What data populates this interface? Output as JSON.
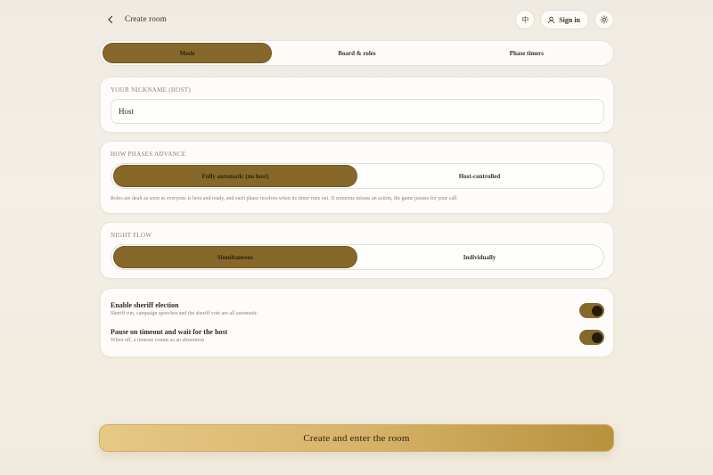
{
  "header": {
    "title": "Create room",
    "lang_glyph": "中",
    "signin_label": "Sign in"
  },
  "tabs": [
    {
      "label": "Mode",
      "active": true
    },
    {
      "label": "Board & roles",
      "active": false
    },
    {
      "label": "Phase timers",
      "active": false
    }
  ],
  "nickname": {
    "label": "YOUR NICKNAME (HOST)",
    "value": "Host"
  },
  "phases": {
    "label": "HOW PHASES ADVANCE",
    "options": [
      {
        "label": "Fully automatic (no host)",
        "active": true
      },
      {
        "label": "Host-controlled",
        "active": false
      }
    ],
    "note": "Roles are dealt as soon as everyone is here and ready, and each phase resolves when its timer runs out. If someone misses an action, the game pauses for your call."
  },
  "night": {
    "label": "NIGHT FLOW",
    "options": [
      {
        "label": "Simultaneous",
        "active": true
      },
      {
        "label": "Individually",
        "active": false
      }
    ]
  },
  "toggles": [
    {
      "title": "Enable sheriff election",
      "desc": "Sheriff run, campaign speeches and the sheriff vote are all automatic.",
      "on": true
    },
    {
      "title": "Pause on timeout and wait for the host",
      "desc": "When off, a timeout counts as an abstention",
      "on": true
    }
  ],
  "cta_label": "Create and enter the room",
  "colors": {
    "accent": "#86692a",
    "cta_start": "#e6c985",
    "cta_end": "#b8913e",
    "background": "#f1ede4"
  }
}
